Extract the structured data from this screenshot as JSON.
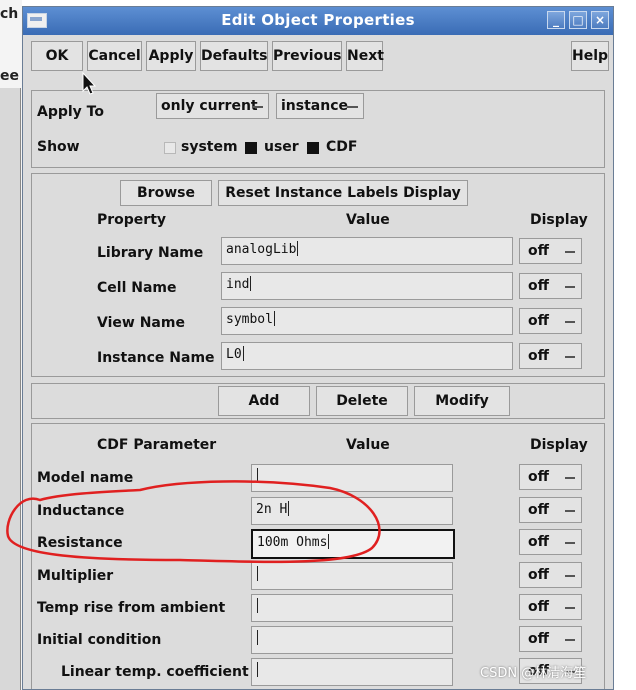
{
  "background": {
    "fragments": [
      "ch",
      "ee"
    ]
  },
  "window": {
    "title": "Edit Object Properties",
    "controls": {
      "minimize": "_",
      "maximize": "□",
      "close": "×"
    }
  },
  "toolbar": {
    "ok": "OK",
    "cancel": "Cancel",
    "apply": "Apply",
    "defaults": "Defaults",
    "previous": "Previous",
    "next": "Next",
    "help": "Help"
  },
  "apply_section": {
    "apply_to_label": "Apply To",
    "apply_to_scope": "only current",
    "apply_to_type": "instance",
    "show_label": "Show",
    "show_options": [
      {
        "label": "system",
        "checked": false
      },
      {
        "label": "user",
        "checked": true
      },
      {
        "label": "CDF",
        "checked": true
      }
    ]
  },
  "properties": {
    "browse": "Browse",
    "reset_labels": "Reset Instance Labels Display",
    "headers": {
      "property": "Property",
      "value": "Value",
      "display": "Display"
    },
    "rows": [
      {
        "label": "Library Name",
        "value": "analogLib",
        "display": "off"
      },
      {
        "label": "Cell Name",
        "value": "ind",
        "display": "off"
      },
      {
        "label": "View Name",
        "value": "symbol",
        "display": "off"
      },
      {
        "label": "Instance Name",
        "value": "L0",
        "display": "off"
      }
    ]
  },
  "actions": {
    "add": "Add",
    "delete": "Delete",
    "modify": "Modify"
  },
  "cdf": {
    "headers": {
      "parameter": "CDF Parameter",
      "value": "Value",
      "display": "Display"
    },
    "rows": [
      {
        "label": "Model name",
        "value": "",
        "display": "off"
      },
      {
        "label": "Inductance",
        "value": "2n H",
        "display": "off"
      },
      {
        "label": "Resistance",
        "value": "100m Ohms",
        "display": "off"
      },
      {
        "label": "Multiplier",
        "value": "",
        "display": "off"
      },
      {
        "label": "Temp rise from ambient",
        "value": "",
        "display": "off"
      },
      {
        "label": "Initial condition",
        "value": "",
        "display": "off"
      },
      {
        "label": "Linear temp. coefficient",
        "value": "",
        "display": "off"
      }
    ]
  },
  "watermark": "CSDN @林清海笙",
  "colors": {
    "titlebar": "#4a7cc4",
    "annotation": "#e02020",
    "dialog": "#dcdcdc"
  }
}
